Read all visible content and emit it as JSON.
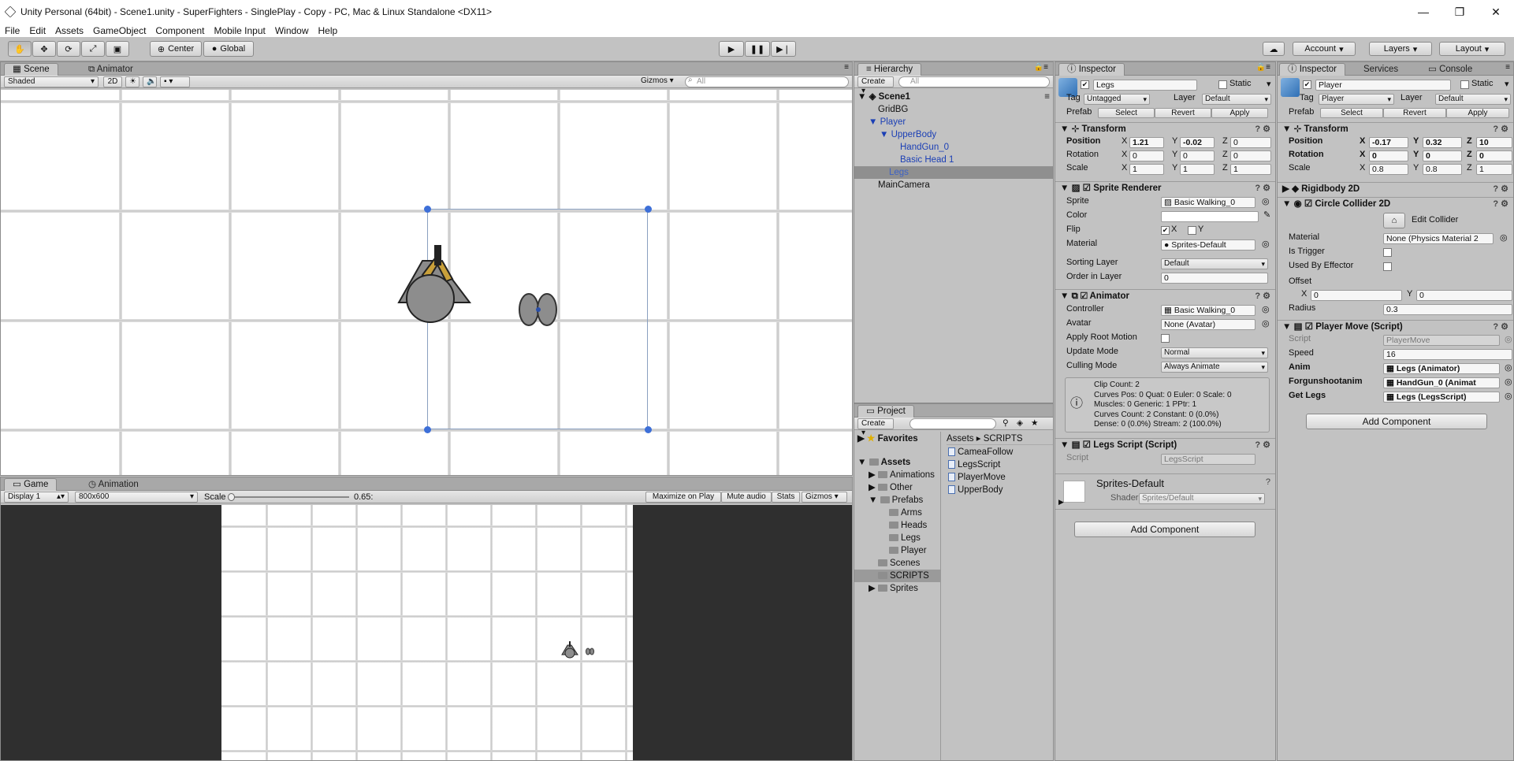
{
  "window": {
    "title": "Unity Personal (64bit) - Scene1.unity - SuperFighters - SinglePlay - Copy - PC, Mac & Linux Standalone <DX11>",
    "min": "—",
    "restore": "❐",
    "close": "✕"
  },
  "menu": [
    "File",
    "Edit",
    "Assets",
    "GameObject",
    "Component",
    "Mobile Input",
    "Window",
    "Help"
  ],
  "toolbar": {
    "pivot": "Center",
    "space": "Global",
    "account": "Account",
    "layers": "Layers",
    "layout": "Layout"
  },
  "scene_panel": {
    "tab_scene": "Scene",
    "tab_animator": "Animator",
    "shading": "Shaded",
    "mode_2d": "2D",
    "gizmos": "Gizmos",
    "search": "All"
  },
  "game_panel": {
    "tab_game": "Game",
    "tab_animation": "Animation",
    "display": "Display 1",
    "resolution": "800x600",
    "scale_label": "Scale",
    "scale_value": "0.65:",
    "scale_fraction": 0.0,
    "maximize": "Maximize on Play",
    "mute": "Mute audio",
    "stats": "Stats",
    "gizmos": "Gizmos"
  },
  "hierarchy": {
    "tab": "Hierarchy",
    "create": "Create",
    "search": "All",
    "scene": "Scene1",
    "items": [
      {
        "label": "GridBG"
      },
      {
        "label": "Player"
      },
      {
        "label": "UpperBody"
      },
      {
        "label": "HandGun_0"
      },
      {
        "label": "Basic Head 1"
      },
      {
        "label": "Legs"
      },
      {
        "label": "MainCamera"
      }
    ]
  },
  "project": {
    "tab": "Project",
    "create": "Create",
    "favorites": "Favorites",
    "assets": "Assets",
    "tree": [
      "Animations",
      "Other",
      "Prefabs",
      "Arms",
      "Heads",
      "Legs",
      "Player",
      "Scenes",
      "SCRIPTS",
      "Sprites"
    ],
    "breadcrumb": [
      "Assets",
      "SCRIPTS"
    ],
    "files": [
      "CameaFollow",
      "LegsScript",
      "PlayerMove",
      "UpperBody"
    ]
  },
  "inspector1": {
    "tab": "Inspector",
    "name": "Legs",
    "static": "Static",
    "tag_label": "Tag",
    "tag": "Untagged",
    "layer_label": "Layer",
    "layer": "Default",
    "prefab": "Prefab",
    "select": "Select",
    "revert": "Revert",
    "apply": "Apply",
    "transform": {
      "title": "Transform",
      "position": "Position",
      "rotation": "Rotation",
      "scale": "Scale",
      "px": "1.21",
      "py": "-0.02",
      "pz": "0",
      "rx": "0",
      "ry": "0",
      "rz": "0",
      "sx": "1",
      "sy": "1",
      "sz": "1"
    },
    "sprite_renderer": {
      "title": "Sprite Renderer",
      "sprite_label": "Sprite",
      "sprite": "Basic Walking_0",
      "color_label": "Color",
      "flip_label": "Flip",
      "flip_x": "X",
      "flip_y": "Y",
      "material_label": "Material",
      "material": "Sprites-Default",
      "sorting_label": "Sorting Layer",
      "sorting": "Default",
      "order_label": "Order in Layer",
      "order": "0"
    },
    "animator": {
      "title": "Animator",
      "controller_label": "Controller",
      "controller": "Basic Walking_0",
      "avatar_label": "Avatar",
      "avatar": "None (Avatar)",
      "root_label": "Apply Root Motion",
      "update_label": "Update Mode",
      "update": "Normal",
      "culling_label": "Culling Mode",
      "culling": "Always Animate",
      "info": [
        "Clip Count: 2",
        "Curves Pos: 0 Quat: 0 Euler: 0 Scale: 0",
        "Muscles: 0 Generic: 1 PPtr: 1",
        "Curves Count: 2 Constant: 0 (0.0%)",
        "Dense: 0 (0.0%) Stream: 2 (100.0%)"
      ]
    },
    "legs_script": {
      "title": "Legs Script (Script)",
      "script_label": "Script",
      "script": "LegsScript"
    },
    "material": {
      "name": "Sprites-Default",
      "shader_label": "Shader",
      "shader": "Sprites/Default"
    },
    "add_component": "Add Component"
  },
  "inspector2": {
    "tab": "Inspector",
    "tab_services": "Services",
    "tab_console": "Console",
    "name": "Player",
    "static": "Static",
    "tag_label": "Tag",
    "tag": "Player",
    "layer_label": "Layer",
    "layer": "Default",
    "prefab": "Prefab",
    "select": "Select",
    "revert": "Revert",
    "apply": "Apply",
    "transform": {
      "title": "Transform",
      "position": "Position",
      "rotation": "Rotation",
      "scale": "Scale",
      "px": "-0.17",
      "py": "0.32",
      "pz": "10",
      "rx": "0",
      "ry": "0",
      "rz": "0",
      "sx": "0.8",
      "sy": "0.8",
      "sz": "1"
    },
    "rigidbody": "Rigidbody 2D",
    "collider": {
      "title": "Circle Collider 2D",
      "edit": "Edit Collider",
      "material_label": "Material",
      "material": "None (Physics Material 2",
      "trigger_label": "Is Trigger",
      "effector_label": "Used By Effector",
      "offset_label": "Offset",
      "ox": "0",
      "oy": "0",
      "radius_label": "Radius",
      "radius": "0.3"
    },
    "player_move": {
      "title": "Player Move (Script)",
      "script_label": "Script",
      "script": "PlayerMove",
      "speed_label": "Speed",
      "speed": "16",
      "anim_label": "Anim",
      "anim": "Legs (Animator)",
      "gun_label": "Forgunshootanim",
      "gun": "HandGun_0 (Animat",
      "legs_label": "Get Legs",
      "legs": "Legs (LegsScript)"
    },
    "add_component": "Add Component"
  },
  "axis": {
    "x": "X",
    "y": "Y",
    "z": "Z"
  }
}
